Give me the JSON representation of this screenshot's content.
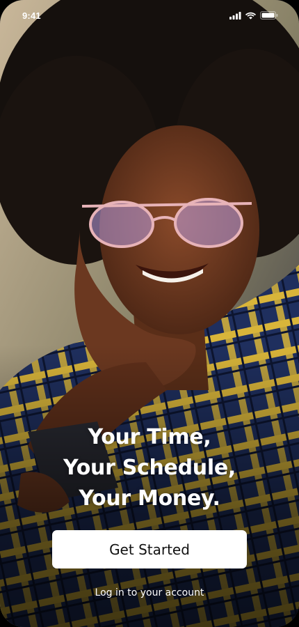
{
  "status_bar": {
    "time": "9:41",
    "icons": [
      "signal-icon",
      "wifi-icon",
      "battery-icon"
    ]
  },
  "hero": {
    "headline_lines": [
      "Your Time,",
      "Your Schedule,",
      "Your Money."
    ],
    "primary_button": "Get Started",
    "secondary_link": "Log in to your account"
  },
  "colors": {
    "text": "#FFFFFF",
    "button_bg": "#FFFFFF",
    "button_text": "#111111"
  }
}
